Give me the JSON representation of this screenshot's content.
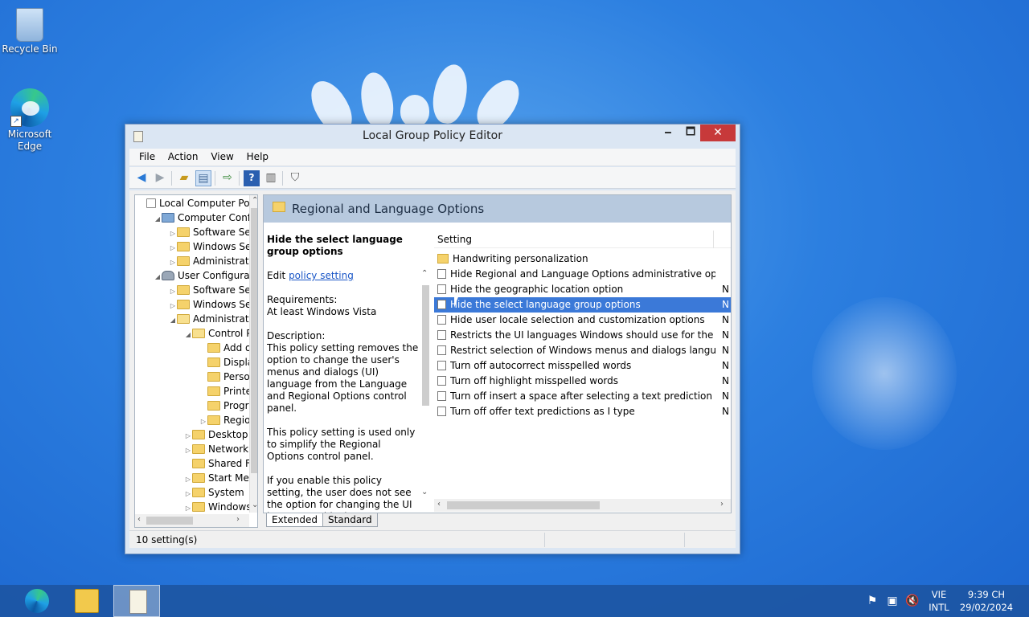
{
  "desktop": {
    "icons": [
      {
        "label": "Recycle Bin",
        "icon": "recycle-bin-icon"
      },
      {
        "label": "Microsoft Edge",
        "icon": "edge-icon"
      }
    ]
  },
  "window": {
    "title": "Local Group Policy Editor",
    "controls": {
      "minimize": "🗕",
      "maximize": "🗖",
      "close": "✕"
    },
    "menu": [
      "File",
      "Action",
      "View",
      "Help"
    ],
    "toolbar_icons": [
      "back-icon",
      "forward-icon",
      "up-folder-icon",
      "show-hide-tree-icon",
      "export-list-icon",
      "help-icon",
      "properties-icon",
      "filter-icon"
    ],
    "tree": {
      "rows": [
        {
          "label": "Local Computer Polic",
          "exp": "",
          "icon": "doc",
          "level": 0
        },
        {
          "label": "Computer Configu",
          "exp": "◢",
          "icon": "comp",
          "level": 1
        },
        {
          "label": "Software Setti",
          "exp": "▷",
          "icon": "folder",
          "level": 2
        },
        {
          "label": "Windows Sett",
          "exp": "▷",
          "icon": "folder",
          "level": 2
        },
        {
          "label": "Administrative",
          "exp": "▷",
          "icon": "folder",
          "level": 2
        },
        {
          "label": "User Configuratio",
          "exp": "◢",
          "icon": "user",
          "level": 1
        },
        {
          "label": "Software Setti",
          "exp": "▷",
          "icon": "folder",
          "level": 2
        },
        {
          "label": "Windows Sett",
          "exp": "▷",
          "icon": "folder",
          "level": 2
        },
        {
          "label": "Administrative",
          "exp": "◢",
          "icon": "open",
          "level": 2
        },
        {
          "label": "Control Pa",
          "exp": "◢",
          "icon": "open",
          "level": 3
        },
        {
          "label": "Add or",
          "exp": "",
          "icon": "folder",
          "level": 4
        },
        {
          "label": "Display",
          "exp": "",
          "icon": "folder",
          "level": 4
        },
        {
          "label": "Person",
          "exp": "",
          "icon": "folder",
          "level": 4
        },
        {
          "label": "Printer",
          "exp": "",
          "icon": "folder",
          "level": 4
        },
        {
          "label": "Progra",
          "exp": "",
          "icon": "folder",
          "level": 4
        },
        {
          "label": "Region",
          "exp": "▷",
          "icon": "folder",
          "level": 4
        },
        {
          "label": "Desktop",
          "exp": "▷",
          "icon": "folder",
          "level": 3
        },
        {
          "label": "Network",
          "exp": "▷",
          "icon": "folder",
          "level": 3
        },
        {
          "label": "Shared Fol",
          "exp": "",
          "icon": "folder",
          "level": 3
        },
        {
          "label": "Start Menu",
          "exp": "▷",
          "icon": "folder",
          "level": 3
        },
        {
          "label": "System",
          "exp": "▷",
          "icon": "folder",
          "level": 3
        },
        {
          "label": "Windows (",
          "exp": "▷",
          "icon": "folder",
          "level": 3
        }
      ]
    },
    "header_title": "Regional and Language Options",
    "description": {
      "title": "Hide the select language group options",
      "edit_prefix": "Edit ",
      "edit_link": "policy setting ",
      "requirements_label": "Requirements:",
      "requirements_value": "At least Windows Vista",
      "description_label": "Description:",
      "para1": "This policy setting removes the option to change the user's menus and dialogs (UI) language from the Language and Regional Options control panel.",
      "para2": "This policy setting is used only to simplify the Regional Options control panel.",
      "para3": "If you enable this policy setting, the user does not see the option for changing the UI language. This does not prevent the user or an"
    },
    "list": {
      "column_setting": "Setting",
      "rows": [
        {
          "text": "Handwriting personalization",
          "state": "",
          "folder": true,
          "selected": false
        },
        {
          "text": "Hide Regional and Language Options administrative options",
          "state": "",
          "folder": false,
          "selected": false
        },
        {
          "text": "Hide the geographic location option",
          "state": "N",
          "folder": false,
          "selected": false
        },
        {
          "text": "Hide the select language group options",
          "state": "N",
          "folder": false,
          "selected": true
        },
        {
          "text": "Hide user locale selection and customization options",
          "state": "N",
          "folder": false,
          "selected": false
        },
        {
          "text": "Restricts the UI languages Windows should use for the selec...",
          "state": "N",
          "folder": false,
          "selected": false
        },
        {
          "text": "Restrict selection of Windows menus and dialogs language",
          "state": "N",
          "folder": false,
          "selected": false
        },
        {
          "text": "Turn off autocorrect misspelled words",
          "state": "N",
          "folder": false,
          "selected": false
        },
        {
          "text": "Turn off highlight misspelled words",
          "state": "N",
          "folder": false,
          "selected": false
        },
        {
          "text": "Turn off insert a space after selecting a text prediction",
          "state": "N",
          "folder": false,
          "selected": false
        },
        {
          "text": "Turn off offer text predictions as I type",
          "state": "N",
          "folder": false,
          "selected": false
        }
      ]
    },
    "tabs": [
      "Extended",
      "Standard"
    ],
    "status": "10 setting(s)"
  },
  "taskbar": {
    "apps": [
      "edge-icon",
      "file-explorer-icon",
      "group-policy-editor-icon"
    ],
    "tray_icons": [
      "action-center-flag-icon",
      "network-icon",
      "volume-muted-icon"
    ],
    "language_line1": "VIE",
    "language_line2": "INTL",
    "time": "9:39 CH",
    "date": "29/02/2024"
  }
}
